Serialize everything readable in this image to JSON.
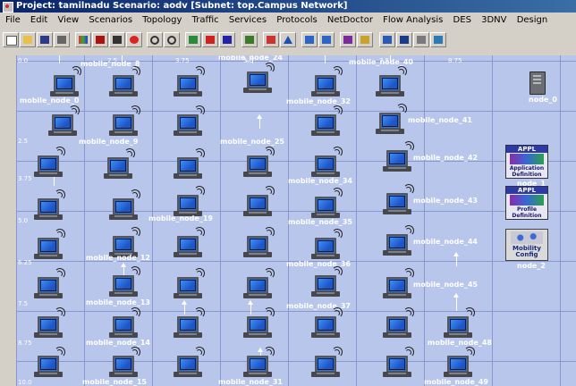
{
  "title": "Project: tamilnadu Scenario: aodv  [Subnet: top.Campus Network]",
  "menu": [
    "File",
    "Edit",
    "View",
    "Scenarios",
    "Topology",
    "Traffic",
    "Services",
    "Protocols",
    "NetDoctor",
    "Flow Analysis",
    "DES",
    "3DNV",
    "Design"
  ],
  "toolbar_icons": [
    "new-icon",
    "open-icon",
    "save-icon",
    "print-icon",
    "palette-icon",
    "grid-icon",
    "node-icon",
    "error-icon",
    "zoom-in-icon",
    "zoom-out-icon",
    "ace-icon",
    "cfg-icon",
    "vne-icon",
    "bar-icon",
    "topology-icon",
    "triangle-icon",
    "link-icon",
    "link2-icon",
    "draw-icon",
    "star-icon",
    "chart-icon",
    "table-icon",
    "window-icon",
    "extra-icon"
  ],
  "ruler_x": [
    "0.0",
    "2.5",
    "3.75",
    "5.0",
    "6.25",
    "7.5",
    "8.75"
  ],
  "ruler_y": [
    "2.5",
    "3.75",
    "5.0",
    "6.25",
    "7.5",
    "8.75",
    "10.0"
  ],
  "node_labels": {
    "n0": "mobile_node_0",
    "n8": "mobile_node_8",
    "n24": "mobile_node_24",
    "n40": "mobile_node_40",
    "n32": "mobile_node_32",
    "n41": "mobile_node_41",
    "n9": "mobile_node_9",
    "n25": "mobile_node_25",
    "n42": "mobile_node_42",
    "n34": "mobile_node_34",
    "n43": "mobile_node_43",
    "n19": "mobile_node_19",
    "n35": "mobile_node_35",
    "n44": "mobile_node_44",
    "n12": "mobile_node_12",
    "n36": "mobile_node_36",
    "n45": "mobile_node_45",
    "n13": "mobile_node_13",
    "n37": "mobile_node_37",
    "n14": "mobile_node_14",
    "n48": "mobile_node_48",
    "n15": "mobile_node_15",
    "n31": "mobile_node_31",
    "n49": "mobile_node_49"
  },
  "special_nodes": {
    "server_label": "node_0",
    "app_def_head": "APPL",
    "app_def_body": "Application Definition",
    "app_def_label": "node_1",
    "profile_head": "APPL",
    "profile_body": "Profile Definition",
    "mobility_body": "Mobility Config",
    "mobility_label": "node_2"
  }
}
